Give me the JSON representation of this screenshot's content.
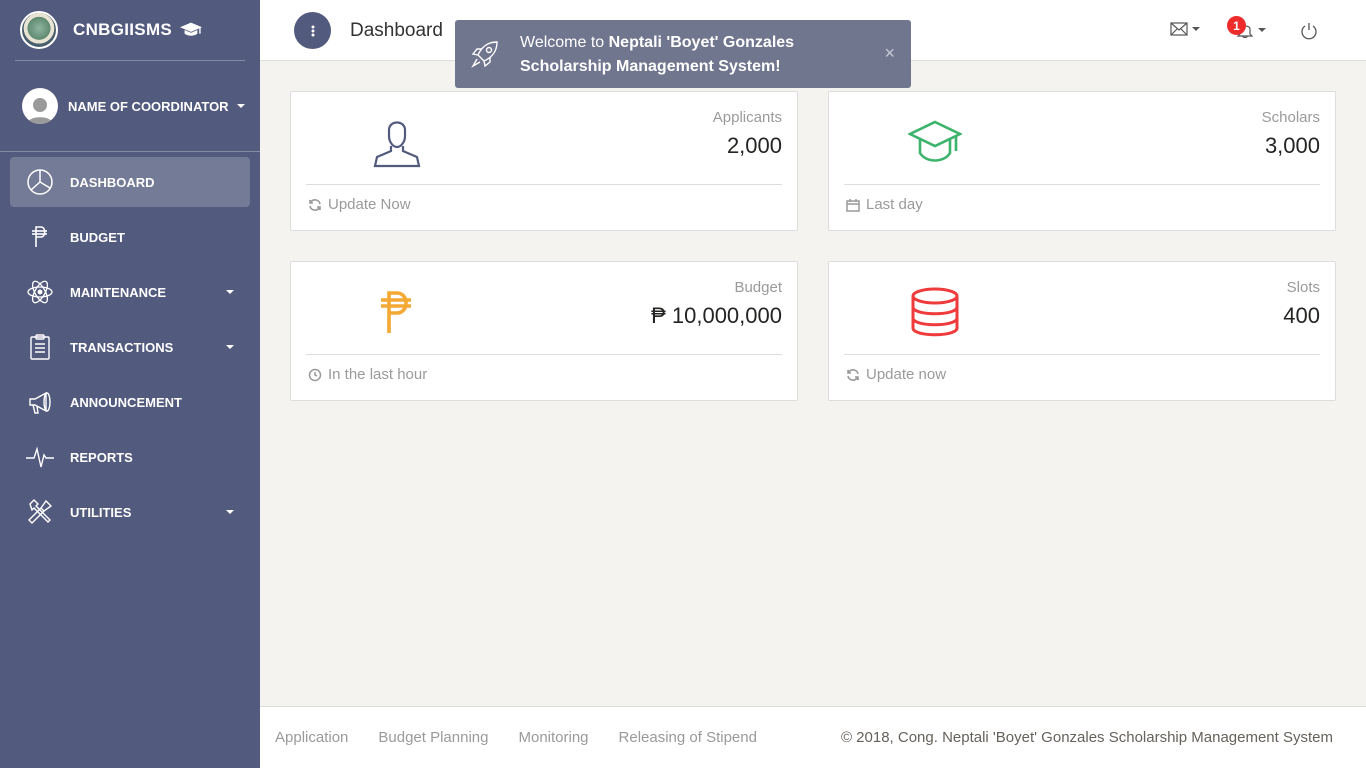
{
  "sidebar": {
    "brand": "CNBGIISMS",
    "user_name": "NAME OF COORDINATOR",
    "items": [
      {
        "label": "DASHBOARD",
        "icon": "pie-chart-icon",
        "active": true,
        "has_caret": false
      },
      {
        "label": "BUDGET",
        "icon": "peso-icon",
        "active": false,
        "has_caret": false
      },
      {
        "label": "MAINTENANCE",
        "icon": "atom-icon",
        "active": false,
        "has_caret": true
      },
      {
        "label": "TRANSACTIONS",
        "icon": "clipboard-icon",
        "active": false,
        "has_caret": true
      },
      {
        "label": "ANNOUNCEMENT",
        "icon": "megaphone-icon",
        "active": false,
        "has_caret": false
      },
      {
        "label": "REPORTS",
        "icon": "pulse-icon",
        "active": false,
        "has_caret": false
      },
      {
        "label": "UTILITIES",
        "icon": "tools-icon",
        "active": false,
        "has_caret": true
      }
    ]
  },
  "topbar": {
    "title": "Dashboard",
    "notification_count": "1"
  },
  "notification": {
    "prefix": "Welcome to ",
    "bold": "Neptali 'Boyet' Gonzales Scholarship Management System",
    "suffix": "!",
    "close": "×"
  },
  "cards": [
    {
      "title": "Applicants",
      "value": "2,000",
      "footer": "Update Now",
      "icon": "user-icon",
      "icon_color": "#525a7e",
      "footer_icon": "refresh-icon"
    },
    {
      "title": "Scholars",
      "value": "3,000",
      "footer": "Last day",
      "icon": "graduation-cap-icon",
      "icon_color": "#3cb36a",
      "footer_icon": "calendar-icon"
    },
    {
      "title": "Budget",
      "value": "₱ 10,000,000",
      "footer": "In the last hour",
      "icon": "peso-icon",
      "icon_color": "#f3a933",
      "footer_icon": "clock-icon"
    },
    {
      "title": "Slots",
      "value": "400",
      "footer": "Update now",
      "icon": "database-icon",
      "icon_color": "#ef3b3b",
      "footer_icon": "refresh-icon"
    }
  ],
  "footer": {
    "links": [
      "Application",
      "Budget Planning",
      "Monitoring",
      "Releasing of Stipend"
    ],
    "copyright": "© 2018, Cong. Neptali 'Boyet' Gonzales Scholarship Management System"
  }
}
